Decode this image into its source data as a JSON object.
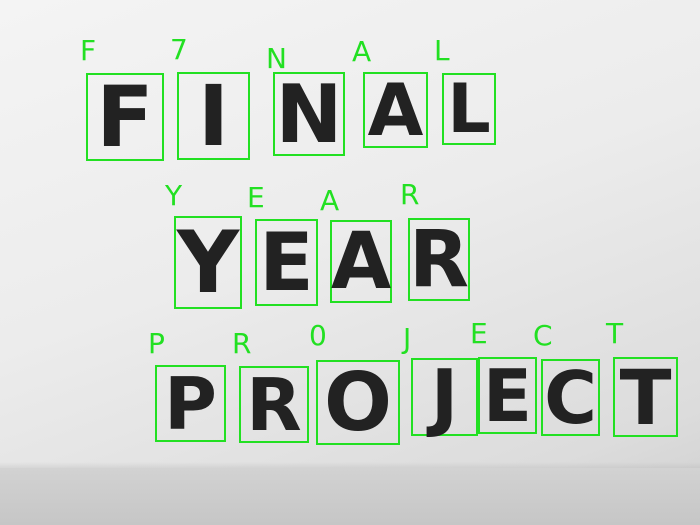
{
  "image": {
    "description_words": [
      "FINAL",
      "YEAR",
      "PROJECT"
    ],
    "box_color": "#22e022",
    "ink_color": "#222222"
  },
  "words": [
    {
      "name": "final",
      "letters": [
        {
          "handwritten": "F",
          "predicted": "F"
        },
        {
          "handwritten": "I",
          "predicted": "7"
        },
        {
          "handwritten": "N",
          "predicted": "N"
        },
        {
          "handwritten": "A",
          "predicted": "A"
        },
        {
          "handwritten": "L",
          "predicted": "L"
        }
      ]
    },
    {
      "name": "year",
      "letters": [
        {
          "handwritten": "Y",
          "predicted": "Y"
        },
        {
          "handwritten": "E",
          "predicted": "E"
        },
        {
          "handwritten": "A",
          "predicted": "A"
        },
        {
          "handwritten": "R",
          "predicted": "R"
        }
      ]
    },
    {
      "name": "project",
      "letters": [
        {
          "handwritten": "P",
          "predicted": "P"
        },
        {
          "handwritten": "R",
          "predicted": "R"
        },
        {
          "handwritten": "O",
          "predicted": "0"
        },
        {
          "handwritten": "J",
          "predicted": "J"
        },
        {
          "handwritten": "E",
          "predicted": "E"
        },
        {
          "handwritten": "C",
          "predicted": "C"
        },
        {
          "handwritten": "T",
          "predicted": "T"
        }
      ]
    }
  ]
}
